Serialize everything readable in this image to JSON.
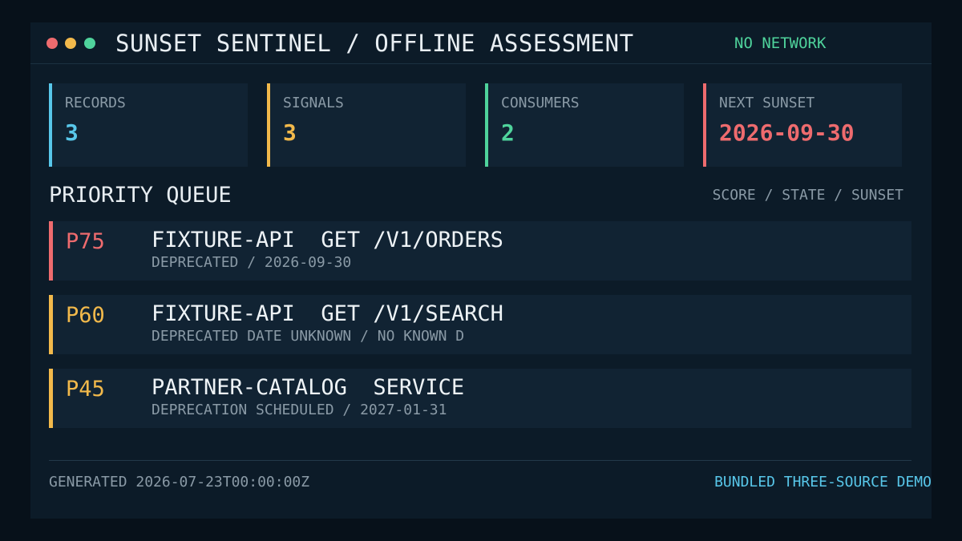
{
  "window": {
    "title": "SUNSET SENTINEL / OFFLINE ASSESSMENT",
    "status": "NO NETWORK",
    "controls": [
      "close",
      "minimize",
      "maximize"
    ]
  },
  "colors": {
    "cyan": "#58c7ea",
    "yellow": "#f2b94b",
    "green": "#4fd39c",
    "red": "#ee6b6e"
  },
  "stats": [
    {
      "label": "RECORDS",
      "value": "3",
      "color": "#58c7ea"
    },
    {
      "label": "SIGNALS",
      "value": "3",
      "color": "#f2b94b"
    },
    {
      "label": "CONSUMERS",
      "value": "2",
      "color": "#4fd39c"
    },
    {
      "label": "NEXT SUNSET",
      "value": "2026-09-30",
      "color": "#ee6b6e"
    }
  ],
  "queue": {
    "title": "PRIORITY QUEUE",
    "legend": "SCORE / STATE / SUNSET",
    "items": [
      {
        "score": "P75",
        "title": "FIXTURE-API  GET /V1/ORDERS",
        "subtitle": "DEPRECATED / 2026-09-30",
        "color": "#ee6b6e"
      },
      {
        "score": "P60",
        "title": "FIXTURE-API  GET /V1/SEARCH",
        "subtitle": "DEPRECATED DATE UNKNOWN / NO KNOWN D",
        "color": "#f2b94b"
      },
      {
        "score": "P45",
        "title": "PARTNER-CATALOG  SERVICE",
        "subtitle": "DEPRECATION SCHEDULED / 2027-01-31",
        "color": "#f2b94b"
      }
    ]
  },
  "footer": {
    "generated": "GENERATED 2026-07-23T00:00:00Z",
    "note": "BUNDLED THREE-SOURCE DEMO"
  }
}
